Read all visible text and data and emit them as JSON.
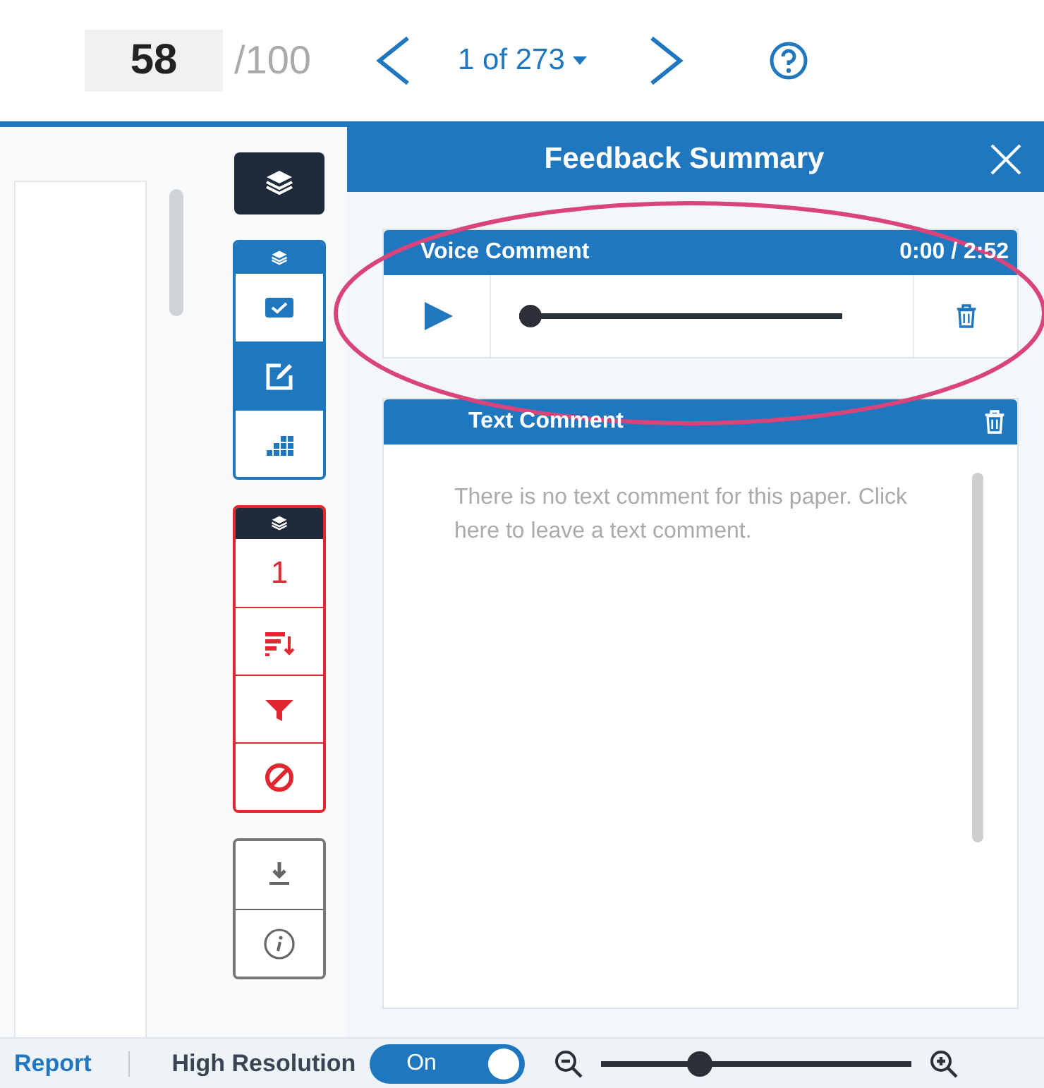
{
  "header": {
    "score": "58",
    "score_total": "/100",
    "pager": "1 of 273"
  },
  "toolbar": {
    "groups": [
      {
        "kind": "dark",
        "buttons": [
          {
            "selected": false
          }
        ]
      },
      {
        "kind": "blue",
        "buttons": [
          {
            "selected": false
          },
          {
            "selected": true
          },
          {
            "selected": false
          }
        ]
      },
      {
        "kind": "red",
        "buttons": [
          {
            "label": "1",
            "selected": false
          },
          {
            "selected": false
          },
          {
            "selected": false
          },
          {
            "selected": false
          }
        ]
      },
      {
        "kind": "grey",
        "buttons": [
          {
            "selected": false
          },
          {
            "selected": false
          }
        ]
      }
    ]
  },
  "panel": {
    "title": "Feedback Summary",
    "voice_comment": {
      "title": "Voice Comment",
      "time": "0:00 / 2:52",
      "level": 0
    },
    "text_comment": {
      "title": "Text Comment",
      "placeholder": "There is no text comment for this paper. Click here to leave a text comment."
    }
  },
  "status_bar": {
    "link": "Report",
    "toggle_label": "High Resolution",
    "toggle": {
      "label": "On",
      "on": true
    },
    "zoom": {
      "level": 0.3
    }
  }
}
